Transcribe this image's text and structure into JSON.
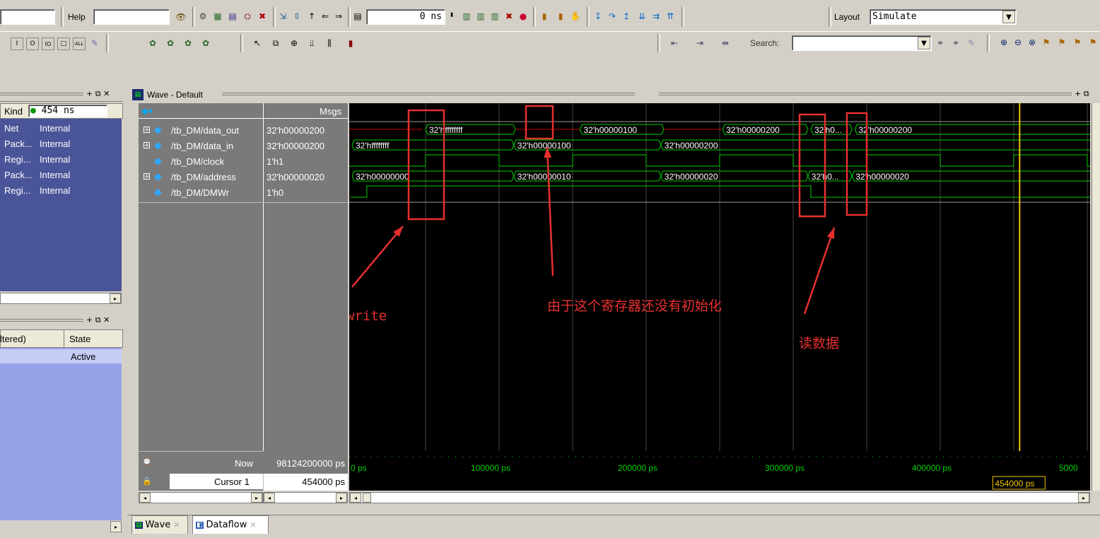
{
  "toolbar": {
    "help_label": "Help",
    "time_value": "0 ns",
    "layout_label": "Layout",
    "layout_value": "Simulate",
    "search_label": "Search:",
    "search_value": "",
    "icons": [
      "zoom-full-icon",
      "zoom-in-icon",
      "zoom-out-icon",
      "find-icon",
      "run-icon",
      "step-icon",
      "break-icon",
      "cursor-icon"
    ]
  },
  "objects_panel": {
    "column_kind": "Kind",
    "time_display": "454 ns",
    "rows": [
      {
        "kind": "Net",
        "mode": "Internal"
      },
      {
        "kind": "Pack...",
        "mode": "Internal"
      },
      {
        "kind": "Regi...",
        "mode": "Internal"
      },
      {
        "kind": "Pack...",
        "mode": "Internal"
      },
      {
        "kind": "Regi...",
        "mode": "Internal"
      }
    ]
  },
  "process_panel": {
    "col_filtered": "ltered)",
    "col_state": "State",
    "state_value": "Active"
  },
  "wave_window": {
    "title": "Wave - Default",
    "msgs_header": "Msgs",
    "signals": [
      {
        "name": "/tb_DM/data_out",
        "value": "32'h00000200",
        "expandable": true
      },
      {
        "name": "/tb_DM/data_in",
        "value": "32'h00000200",
        "expandable": true
      },
      {
        "name": "/tb_DM/clock",
        "value": "1'h1",
        "expandable": false
      },
      {
        "name": "/tb_DM/address",
        "value": "32'h00000020",
        "expandable": true
      },
      {
        "name": "/tb_DM/DMWr",
        "value": "1'h0",
        "expandable": false
      }
    ],
    "bus_labels": {
      "data_out": [
        "32'hffffffff",
        "32'h00000100",
        "32'h00000200",
        "32'h0...",
        "32'h00000200"
      ],
      "data_in": [
        "32'hffffffff",
        "32'h00000100",
        "32'h00000200"
      ],
      "address": [
        "32'h00000000",
        "32'h00000010",
        "32'h00000020",
        "32'h0...",
        "32'h00000020"
      ]
    },
    "now_label": "Now",
    "now_value": "98124200000 ps",
    "cursor_label": "Cursor 1",
    "cursor_value": "454000 ps",
    "cursor_tag": "454000 ps",
    "timeline": [
      "0 ps",
      "100000 ps",
      "200000 ps",
      "300000 ps",
      "400000 ps",
      "5000"
    ]
  },
  "annotations": {
    "write": "write",
    "uninit": "由于这个寄存器还没有初始化",
    "read": "读数据"
  },
  "tabs": [
    {
      "label": "Wave"
    },
    {
      "label": "Dataflow"
    }
  ],
  "colors": {
    "wave_bg": "#000000",
    "signal_green": "#00d000",
    "cursor_yellow": "#f0c800",
    "annotation_red": "#e83030",
    "left_panel": "#8a93d6"
  }
}
